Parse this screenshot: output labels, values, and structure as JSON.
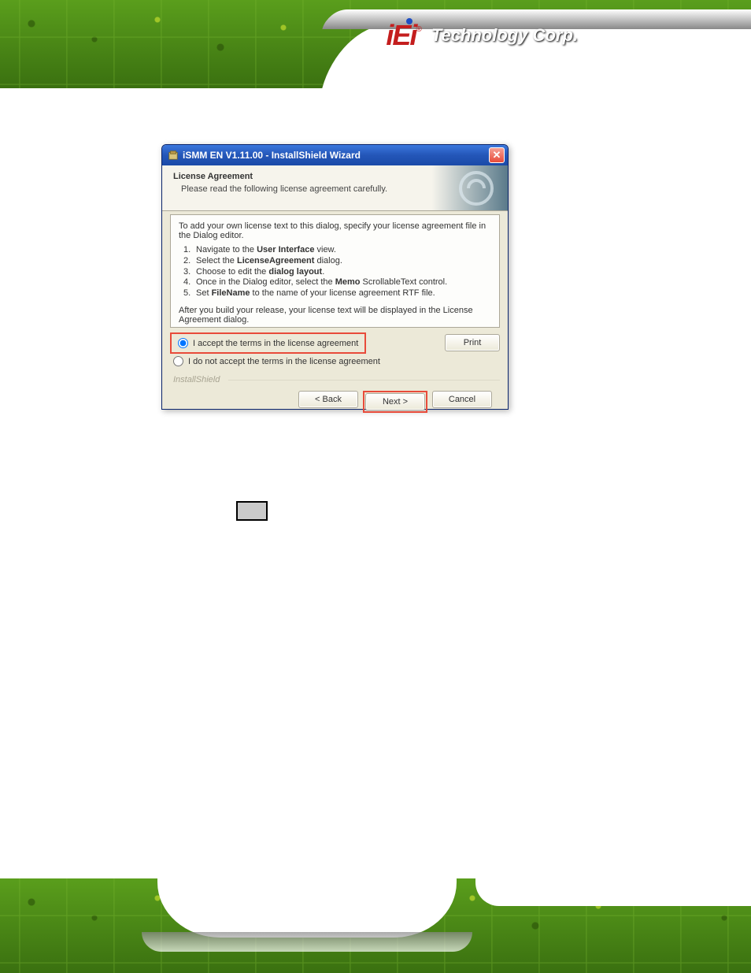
{
  "logo": {
    "mark": "iEi",
    "reg": "®",
    "text": "Technology Corp."
  },
  "dialog": {
    "title": "iSMM EN V1.11.00 - InstallShield Wizard",
    "header_title": "License Agreement",
    "header_sub": "Please read the following license agreement carefully.",
    "license_intro": "To add your own license text to this dialog, specify your license agreement file in the Dialog editor.",
    "steps": [
      {
        "num": "1.",
        "prefix": "Navigate to the ",
        "bold": "User Interface",
        "suffix": " view."
      },
      {
        "num": "2.",
        "prefix": "Select the ",
        "bold": "LicenseAgreement",
        "suffix": " dialog."
      },
      {
        "num": "3.",
        "prefix": "Choose to edit the ",
        "bold": "dialog layout",
        "suffix": "."
      },
      {
        "num": "4.",
        "prefix": "Once in the Dialog editor, select the ",
        "bold": "Memo",
        "suffix": " ScrollableText control."
      },
      {
        "num": "5.",
        "prefix": "Set ",
        "bold": "FileName",
        "suffix": " to the name of your license agreement RTF file."
      }
    ],
    "license_outro": "After you build your release, your license text will be displayed in the License Agreement dialog.",
    "radio_accept": "I accept the terms in the license agreement",
    "radio_decline": "I do not accept the terms in the license agreement",
    "print_label": "Print",
    "installshield_label": "InstallShield",
    "back_label": "< Back",
    "next_label": "Next >",
    "cancel_label": "Cancel"
  }
}
